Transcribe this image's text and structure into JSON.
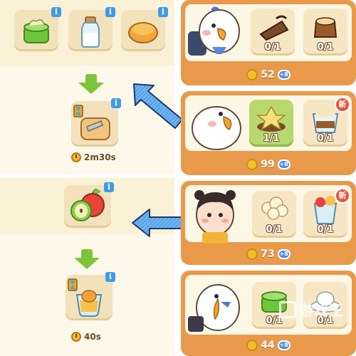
{
  "recipe_top": {
    "ingredients": [
      {
        "name": "green-jelly-icon",
        "has_info": true
      },
      {
        "name": "milk-bottle-icon",
        "has_info": true
      },
      {
        "name": "honey-bowl-icon",
        "has_info": true
      }
    ],
    "product": {
      "name": "toast-icon",
      "has_info": true
    },
    "time": "2m30s"
  },
  "recipe_bottom": {
    "ingredients": [
      {
        "name": "apples-icon",
        "has_info": true
      }
    ],
    "product": {
      "name": "apple-juice-icon",
      "has_info": true
    },
    "time": "40s"
  },
  "info_label": "i",
  "orders": [
    {
      "character": "duck-with-backpack",
      "items": [
        {
          "icon": "chocolate-cake-icon",
          "qty": "0/1",
          "active": false,
          "is_new": false
        },
        {
          "icon": "pudding-icon",
          "qty": "0/1",
          "active": false,
          "is_new": false
        }
      ],
      "reward": "52"
    },
    {
      "character": "white-duck",
      "items": [
        {
          "icon": "flower-dish-icon",
          "qty": "1/1",
          "active": true,
          "is_new": false
        },
        {
          "icon": "dessert-cup-icon",
          "qty": "0/1",
          "active": false,
          "is_new": true
        }
      ],
      "reward": "99"
    },
    {
      "character": "girl-character",
      "items": [
        {
          "icon": "popcorn-icon",
          "qty": "0/1",
          "active": false,
          "is_new": false
        },
        {
          "icon": "fruit-drink-icon",
          "qty": "0/1",
          "active": false,
          "is_new": true
        }
      ],
      "reward": "73"
    },
    {
      "character": "duck-with-bag",
      "items": [
        {
          "icon": "green-jelly-icon",
          "qty": "0/1",
          "active": false,
          "is_new": false
        },
        {
          "icon": "egg-dish-icon",
          "qty": "0/1",
          "active": false,
          "is_new": false
        }
      ],
      "reward": "44"
    }
  ],
  "new_badge_label": "新",
  "plus_label": "+8",
  "watermark_text": "游戏王",
  "colors": {
    "panel_bg": "#fdf8ea",
    "card_frame": "#e9994a",
    "arrow_blue": "#5aa9f0",
    "arrow_green": "#7cc43a",
    "info_blue": "#3d9bea",
    "new_red": "#e8513a",
    "coin_gold": "#f3c02a"
  }
}
